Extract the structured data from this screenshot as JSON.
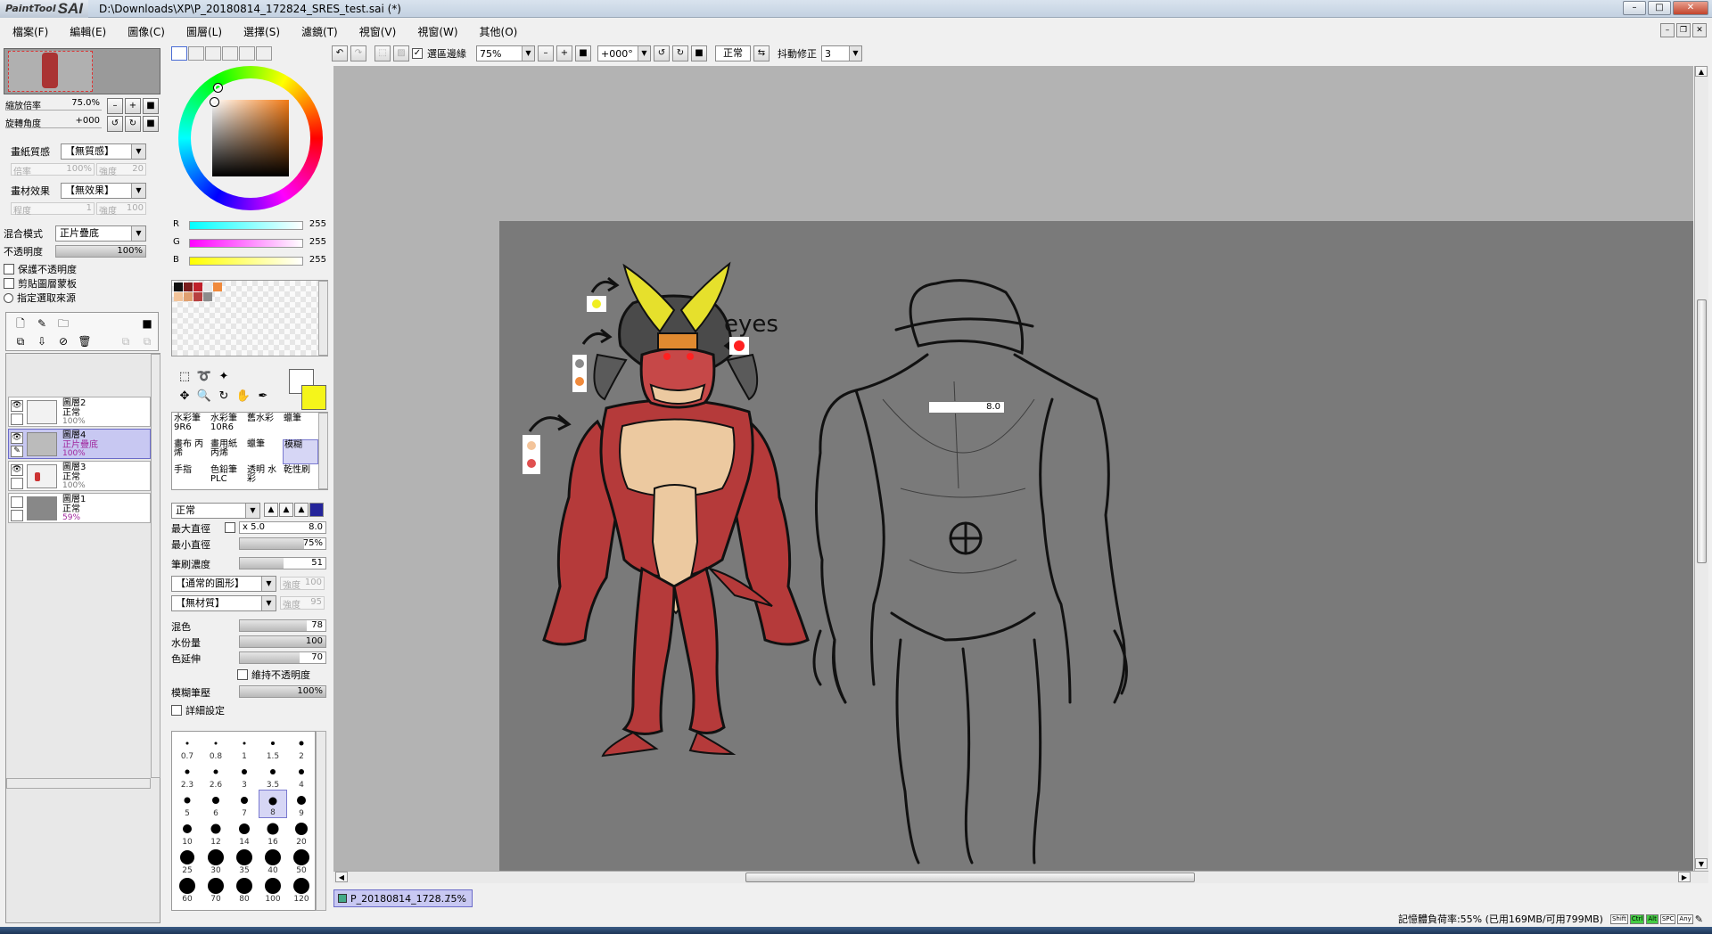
{
  "app": {
    "logo_small": "PaintTool",
    "logo_big": "SAI",
    "title": "D:\\Downloads\\XP\\P_20180814_172824_SRES_test.sai (*)"
  },
  "menu": [
    "檔案(F)",
    "編輯(E)",
    "圖像(C)",
    "圖層(L)",
    "選擇(S)",
    "濾鏡(T)",
    "視窗(V)",
    "視窗(W)",
    "其他(O)"
  ],
  "toolbar": {
    "selection_edge_label": "選區邊緣",
    "selection_edge_checked": true,
    "zoom": "75%",
    "rotation": "+000°",
    "blend_label": "正常",
    "stabilizer_label": "抖動修正",
    "stabilizer_value": "3"
  },
  "navigator": {
    "zoom_label": "縮放倍率",
    "zoom_value": "75.0%",
    "angle_label": "旋轉角度",
    "angle_value": "+000"
  },
  "paper": {
    "texture_label": "畫紙質感",
    "texture_value": "【無質感】",
    "texture_scale_label": "倍率",
    "texture_scale_value": "100%",
    "texture_strength_label": "強度",
    "texture_strength_value": "20",
    "effect_label": "畫材效果",
    "effect_value": "【無效果】",
    "effect_degree_label": "程度",
    "effect_degree_value": "1",
    "effect_strength_label": "強度",
    "effect_strength_value": "100"
  },
  "layer_props": {
    "blend_label": "混合模式",
    "blend_value": "正片疊底",
    "opacity_label": "不透明度",
    "opacity_value": "100%",
    "opacity_fraction": 1.0,
    "preserve_opacity": "保護不透明度",
    "clipping": "剪貼圖層蒙板",
    "selection_source": "指定選取來源"
  },
  "layers": [
    {
      "name": "圖層2",
      "mode": "正常",
      "opacity": "100%",
      "visible": true,
      "selected": false
    },
    {
      "name": "圖層4",
      "mode": "正片疊底",
      "opacity": "100%",
      "visible": true,
      "selected": true
    },
    {
      "name": "圖層3",
      "mode": "正常",
      "opacity": "100%",
      "visible": true,
      "selected": false
    },
    {
      "name": "圖層1",
      "mode": "正常",
      "opacity": "59%",
      "visible": false,
      "selected": false
    }
  ],
  "color": {
    "r_label": "R",
    "r": "255",
    "g_label": "G",
    "g": "255",
    "b_label": "B",
    "b": "255",
    "foreground": "#ffffff",
    "background": "#f5f51a",
    "swatches": [
      "#111111",
      "#7a1d1d",
      "#c0202a",
      "#e8e8e8",
      "#f08a3c",
      "#f3c49a",
      "#e0a070",
      "#b84040",
      "#8c8c8c"
    ]
  },
  "brushes": [
    {
      "label": "水彩筆 9R6",
      "selected": false
    },
    {
      "label": "水彩筆 10R6",
      "selected": false
    },
    {
      "label": "舊水彩",
      "selected": false
    },
    {
      "label": "蠟筆",
      "selected": false
    },
    {
      "label": "畫布 丙烯",
      "selected": false
    },
    {
      "label": "畫用紙 丙烯",
      "selected": false
    },
    {
      "label": "蠟筆",
      "selected": false
    },
    {
      "label": "模糊",
      "selected": true
    },
    {
      "label": "手指",
      "selected": false
    },
    {
      "label": "色鉛筆 PLC",
      "selected": false
    },
    {
      "label": "透明 水彩",
      "selected": false
    },
    {
      "label": "乾性刷",
      "selected": false
    }
  ],
  "brush_settings": {
    "mode": "正常",
    "max_size_label": "最大直徑",
    "max_size_mult": "x 5.0",
    "max_size_value": "8.0",
    "min_size_label": "最小直徑",
    "min_size_value": "75%",
    "min_size_fraction": 0.75,
    "density_label": "筆刷濃度",
    "density_value": "51",
    "density_fraction": 0.51,
    "shape_value": "【通常的圓形】",
    "shape_strength_label": "強度",
    "shape_strength_value": "100",
    "texture_value": "【無材質】",
    "texture_strength_label": "強度",
    "texture_strength_value": "95",
    "blend_label": "混色",
    "blend_value": "78",
    "blend_fraction": 0.78,
    "water_label": "水份量",
    "water_value": "100",
    "water_fraction": 1.0,
    "persist_label": "色延伸",
    "persist_value": "70",
    "persist_fraction": 0.7,
    "keep_opacity_label": "維持不透明度",
    "blur_label": "模糊筆壓",
    "blur_value": "100%",
    "blur_fraction": 1.0,
    "detail_label": "詳細設定"
  },
  "brush_sizes": [
    "0.7",
    "0.8",
    "1",
    "1.5",
    "2",
    "2.3",
    "2.6",
    "3",
    "3.5",
    "4",
    "5",
    "6",
    "7",
    "8",
    "9",
    "10",
    "12",
    "14",
    "16",
    "20",
    "25",
    "30",
    "35",
    "40",
    "50",
    "60",
    "70",
    "80",
    "100",
    "120"
  ],
  "selected_brush_size": "8",
  "canvas": {
    "annotation_eyes": "eyes",
    "size_popup": "8.0"
  },
  "document_tab": {
    "name": "P_20180814_1728...",
    "zoom": "75%"
  },
  "status": {
    "memory": "記憶體負荷率:55% (已用169MB/可用799MB)",
    "indicators": [
      "Shift",
      "Ctrl",
      "Alt",
      "SPC",
      "Any"
    ]
  }
}
